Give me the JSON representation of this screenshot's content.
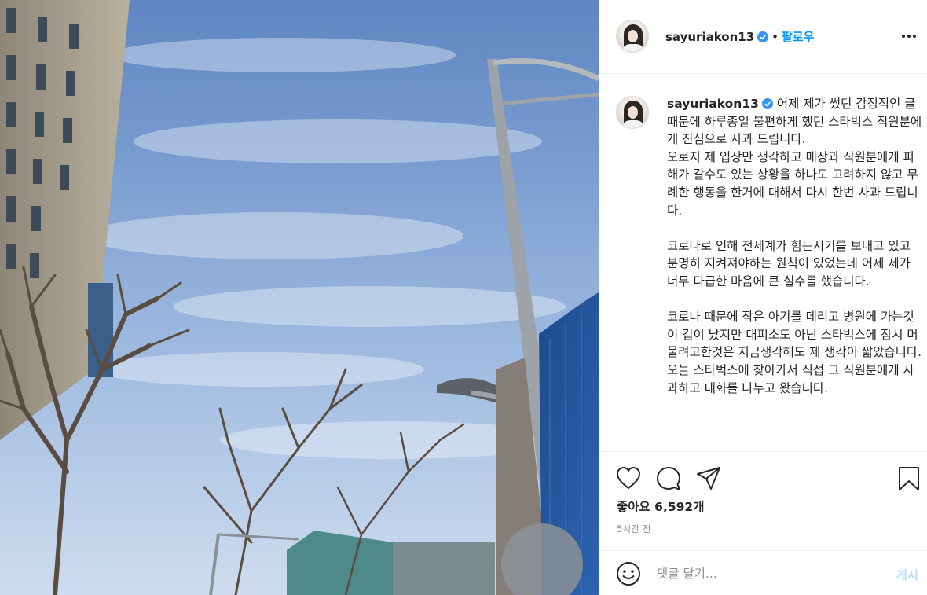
{
  "post": {
    "username": "sayuriakon13",
    "follow_label": "팔로우",
    "follow_separator": "•",
    "more_icon": "more-horizontal-icon",
    "verified_icon": "verified-badge-icon",
    "caption_username": "sayuriakon13",
    "caption_text": " 어제 제가 썼던 감정적인 글 때문에 하루종일 불편하게 했던 스타벅스 직원분에게 진심으로 사과 드립니다.\n오로지 제 입장만 생각하고 매장과 직원분에게 피해가 갈수도 있는 상황을 하나도 고려하지 않고 무례한 행동을 한거에 대해서 다시 한번 사과 드립니다.\n\n코로나로 인해 전세계가 힘든시기를 보내고 있고 분명히 지켜져야하는 원칙이 있었는데 어제 제가 너무 다급한 마음에 큰 실수를 했습니다.\n\n코로나 때문에 작은 아기를 데리고 병원에 가는것이 겁이 났지만 대피소도 아닌 스타벅스에 잠시 머물려고한것은 지금생각해도 제 생각이 짧았습니다. 오늘 스타벅스에 찾아가서 직접 그 직원분에게 사과하고 대화를 나누고 왔습니다.",
    "likes_label": "좋아요 6,592개",
    "time_ago": "5시간 전"
  },
  "actions": {
    "icons": [
      "heart-icon",
      "comment-icon",
      "share-icon",
      "bookmark-icon"
    ]
  },
  "comment": {
    "placeholder": "댓글 달기...",
    "post_label": "게시",
    "emoji_icon": "emoji-icon"
  },
  "colors": {
    "accent": "#0095f6",
    "post_button_disabled": "#b2dffc",
    "secondary_text": "#8e8e8e",
    "border": "#efefef"
  }
}
